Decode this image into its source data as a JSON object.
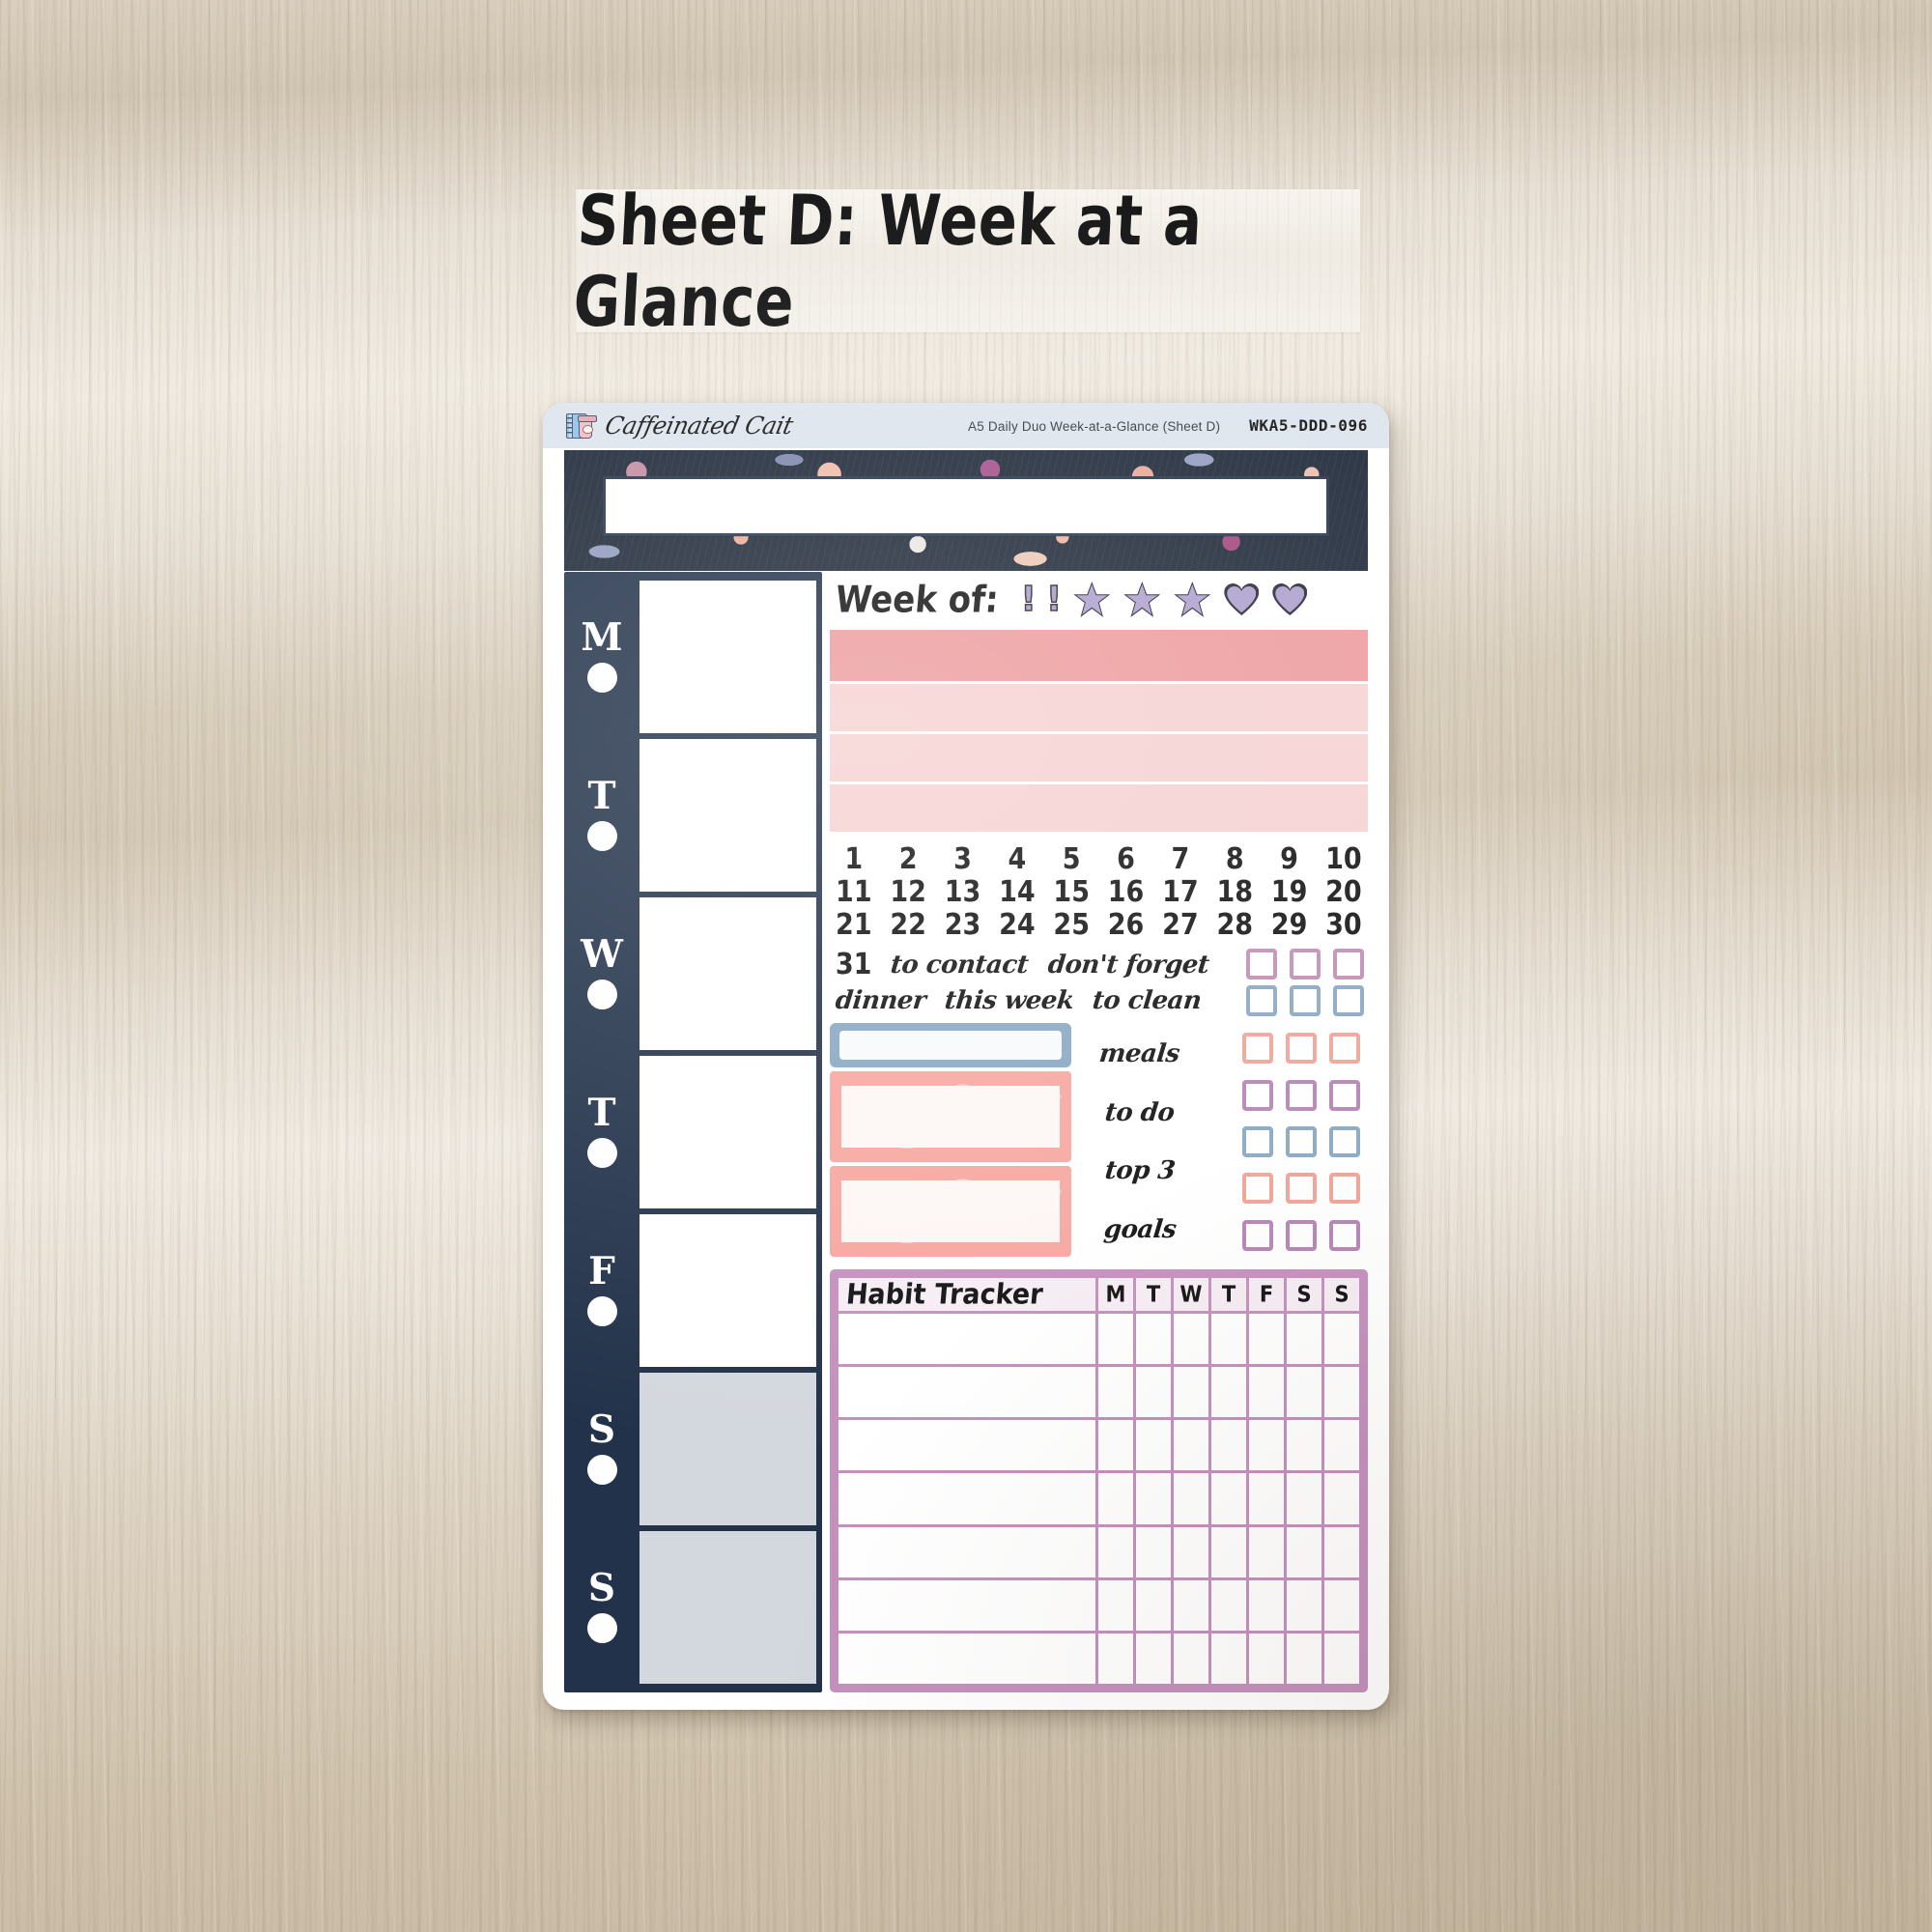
{
  "title_banner": {
    "text": "Sheet D: Week at a Glance"
  },
  "sheet_header": {
    "brand_name": "Caffeinated Cait",
    "brand_icon": "notebook-coffee-icon",
    "description": "A5 Daily Duo Week-at-a-Glance (Sheet D)",
    "code": "WKA5-DDD-096"
  },
  "floral_banner": {
    "label_box": ""
  },
  "days": [
    {
      "letter": "M",
      "weekend": false
    },
    {
      "letter": "T",
      "weekend": false
    },
    {
      "letter": "W",
      "weekend": false
    },
    {
      "letter": "T",
      "weekend": false
    },
    {
      "letter": "F",
      "weekend": false
    },
    {
      "letter": "S",
      "weekend": true
    },
    {
      "letter": "S",
      "weekend": true
    }
  ],
  "week_of": {
    "label": "Week of:",
    "icons": [
      "exclamation",
      "exclamation",
      "star",
      "star",
      "star",
      "heart",
      "heart"
    ],
    "icon_color": "#ac9fcd",
    "icon_outline": "#2b2535"
  },
  "pink_bars": [
    {
      "tone": "strong",
      "color": "#ed9b9d"
    },
    {
      "tone": "light",
      "color": "#f6d1d1"
    },
    {
      "tone": "light",
      "color": "#f6d1d1"
    },
    {
      "tone": "light",
      "color": "#f6d1d1"
    }
  ],
  "date_numbers": [
    [
      "1",
      "2",
      "3",
      "4",
      "5",
      "6",
      "7",
      "8",
      "9",
      "10"
    ],
    [
      "11",
      "12",
      "13",
      "14",
      "15",
      "16",
      "17",
      "18",
      "19",
      "20"
    ],
    [
      "21",
      "22",
      "23",
      "24",
      "25",
      "26",
      "27",
      "28",
      "29",
      "30"
    ]
  ],
  "label_rows": [
    {
      "labels": [
        "31",
        "to contact",
        "don't forget"
      ],
      "checkbox_color": "pink"
    },
    {
      "labels": [
        "dinner",
        "this week",
        "to clean"
      ],
      "checkbox_color": "blue"
    }
  ],
  "list_section": {
    "labels": [
      "meals",
      "to do",
      "top 3",
      "goals"
    ],
    "blue_box": "",
    "floral_boxes": [
      "",
      ""
    ],
    "checkbox_rows": [
      "salmon",
      "purple",
      "blue",
      "salmon",
      "purple"
    ]
  },
  "habit_tracker": {
    "title": "Habit Tracker",
    "day_headers": [
      "M",
      "T",
      "W",
      "T",
      "F",
      "S",
      "S"
    ],
    "rows": [
      "",
      "",
      "",
      "",
      "",
      "",
      ""
    ],
    "frame_color": "#c490bd",
    "header_fill": "#f6edf4"
  },
  "colors": {
    "navy": "#22324a",
    "header_band": "#dce4ed",
    "weekend_gray": "#d3d8de",
    "pink_strong": "#ed9b9d",
    "pink_light": "#f6d1d1",
    "purple": "#b583b5",
    "blue": "#88a7c2",
    "salmon": "#f0a295",
    "lavender": "#ac9fcd"
  }
}
